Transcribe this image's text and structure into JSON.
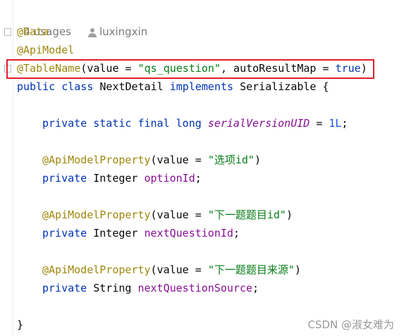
{
  "header": {
    "usages": "4 usages",
    "author": "luxingxin"
  },
  "code": {
    "ann_data": "@Data",
    "ann_apimodel": "@ApiModel",
    "table_ann": "@TableName",
    "table_open": "(value = ",
    "table_value": "\"qs_question\"",
    "table_mid": ", autoResultMap = ",
    "table_bool": "true",
    "table_close": ")",
    "class_kw1": "public",
    "class_kw2": "class",
    "class_name": "NextDetail",
    "class_kw3": "implements",
    "class_iface": "Serializable {",
    "svuid_mods": "private static final long",
    "svuid_name": "serialVersionUID",
    "svuid_eq": " = ",
    "svuid_val": "1L",
    "svuid_end": ";",
    "prop_ann": "@ApiModelProperty",
    "prop_open": "(value = ",
    "prop_close": ")",
    "f1_label": "\"选项id\"",
    "f1_mod": "private",
    "f1_type": "Integer",
    "f1_name": "optionId",
    "f2_label": "\"下一题题目id\"",
    "f2_mod": "private",
    "f2_type": "Integer",
    "f2_name": "nextQuestionId",
    "f3_label": "\"下一题题目来源\"",
    "f3_mod": "private",
    "f3_type": "String",
    "f3_name": "nextQuestionSource",
    "semi": ";",
    "closing_brace": "}"
  },
  "watermark": "CSDN @淑女难为",
  "colors": {
    "annotation": "#9e880d",
    "keyword": "#0033b3",
    "string": "#067d17",
    "number": "#1750eb",
    "field": "#871094",
    "highlight_border": "#e0202e"
  }
}
